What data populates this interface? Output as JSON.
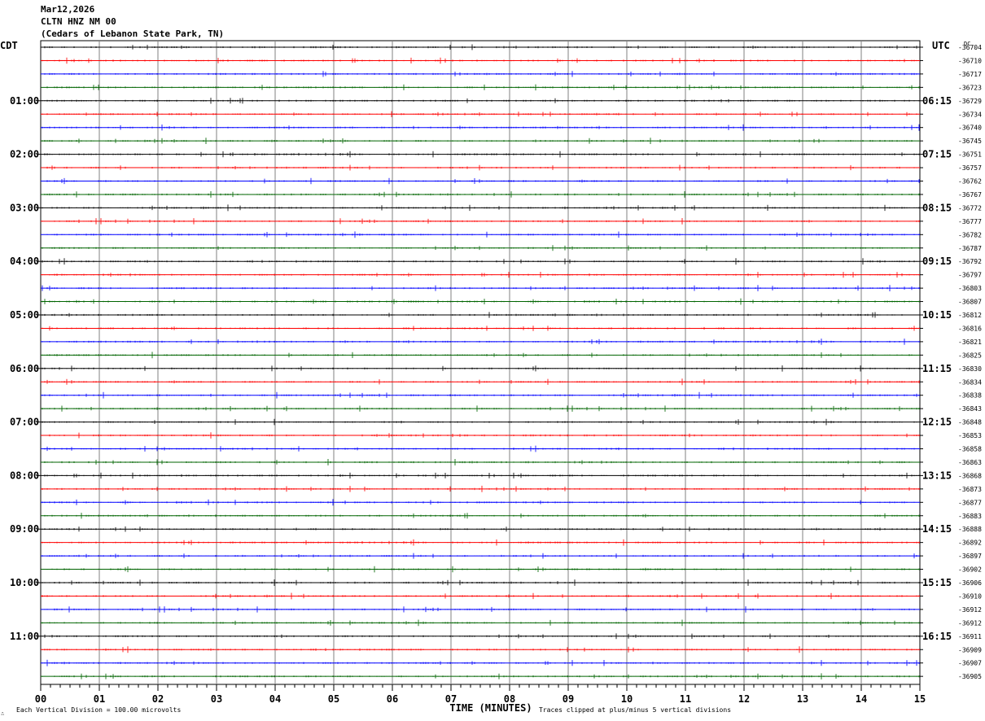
{
  "header": {
    "date": "Mar12,2026",
    "station": "CLTN HNZ NM 00",
    "location": "(Cedars of Lebanon State Park, TN)"
  },
  "chart_data": {
    "type": "line",
    "title": "",
    "left_timezone": "CDT",
    "right_timezone": "UTC",
    "dc_label": "DC",
    "xlabel": "TIME (MINUTES)",
    "x_ticks": [
      "00",
      "01",
      "02",
      "03",
      "04",
      "05",
      "06",
      "07",
      "08",
      "09",
      "10",
      "11",
      "12",
      "13",
      "14",
      "15"
    ],
    "xlim": [
      0,
      15
    ],
    "left_hour_labels": [
      "01:00",
      "02:00",
      "03:00",
      "04:00",
      "05:00",
      "06:00",
      "07:00",
      "08:00",
      "09:00",
      "10:00",
      "11:00"
    ],
    "right_hour_labels": [
      "06:15",
      "07:15",
      "08:15",
      "09:15",
      "10:15",
      "11:15",
      "12:15",
      "13:15",
      "14:15",
      "15:15",
      "16:15"
    ],
    "dc_offsets": [
      "-36704",
      "-36710",
      "-36717",
      "-36723",
      "-36729",
      "-36734",
      "-36740",
      "-36745",
      "-36751",
      "-36757",
      "-36762",
      "-36767",
      "-36772",
      "-36777",
      "-36782",
      "-36787",
      "-36792",
      "-36797",
      "-36803",
      "-36807",
      "-36812",
      "-36816",
      "-36821",
      "-36825",
      "-36830",
      "-36834",
      "-36838",
      "-36843",
      "-36848",
      "-36853",
      "-36858",
      "-36863",
      "-36868",
      "-36873",
      "-36877",
      "-36883",
      "-36888",
      "-36892",
      "-36897",
      "-36902",
      "-36906",
      "-36910",
      "-36912",
      "-36912",
      "-36911",
      "-36909",
      "-36907",
      "-36905"
    ],
    "trace_colors": [
      "#000000",
      "#ff0000",
      "#0000ff",
      "#006400"
    ],
    "grid_color": "#808080",
    "footer_left": "Each Vertical Division =  100.00 microvolts",
    "footer_right": "Traces clipped at plus/minus 5 vertical divisions",
    "corner_mark": "∴"
  }
}
